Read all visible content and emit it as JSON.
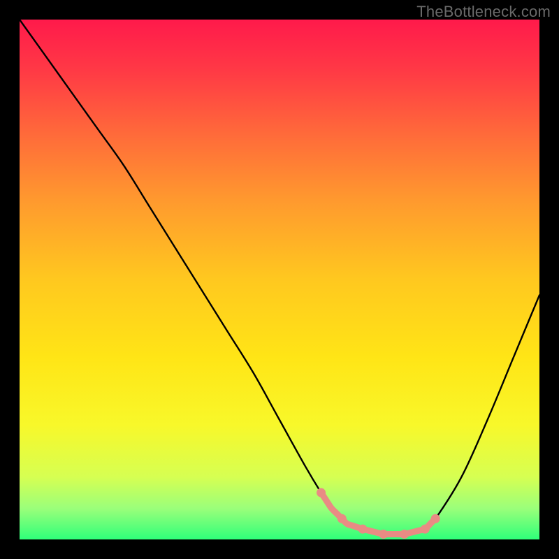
{
  "watermark": "TheBottleneck.com",
  "gradient": {
    "stops": [
      {
        "offset": 0.0,
        "color": "#ff1a4b"
      },
      {
        "offset": 0.1,
        "color": "#ff3a45"
      },
      {
        "offset": 0.22,
        "color": "#ff6a3a"
      },
      {
        "offset": 0.35,
        "color": "#ff9a2e"
      },
      {
        "offset": 0.5,
        "color": "#ffc81f"
      },
      {
        "offset": 0.65,
        "color": "#ffe516"
      },
      {
        "offset": 0.78,
        "color": "#f8f82a"
      },
      {
        "offset": 0.88,
        "color": "#d6ff52"
      },
      {
        "offset": 0.94,
        "color": "#9bff7a"
      },
      {
        "offset": 1.0,
        "color": "#2fff7a"
      }
    ]
  },
  "curve": {
    "stroke": "#000000",
    "width": 2.4,
    "segments_color": "#e98b84",
    "bump_radius": 6.5
  },
  "chart_data": {
    "type": "line",
    "title": "",
    "xlabel": "",
    "ylabel": "",
    "xlim": [
      0,
      100
    ],
    "ylim": [
      0,
      100
    ],
    "series": [
      {
        "name": "bottleneck-curve",
        "x": [
          0,
          5,
          10,
          15,
          20,
          25,
          30,
          35,
          40,
          45,
          50,
          55,
          58,
          60,
          63,
          66,
          70,
          74,
          78,
          80,
          85,
          90,
          95,
          100
        ],
        "y": [
          100,
          93,
          86,
          79,
          72,
          64,
          56,
          48,
          40,
          32,
          23,
          14,
          9,
          6,
          3,
          2,
          1,
          1,
          2,
          4,
          12,
          23,
          35,
          47
        ]
      }
    ],
    "flat_region": {
      "x_start": 58,
      "x_end": 80,
      "bumps_x": [
        58,
        62,
        66,
        70,
        74,
        78,
        80
      ]
    }
  }
}
